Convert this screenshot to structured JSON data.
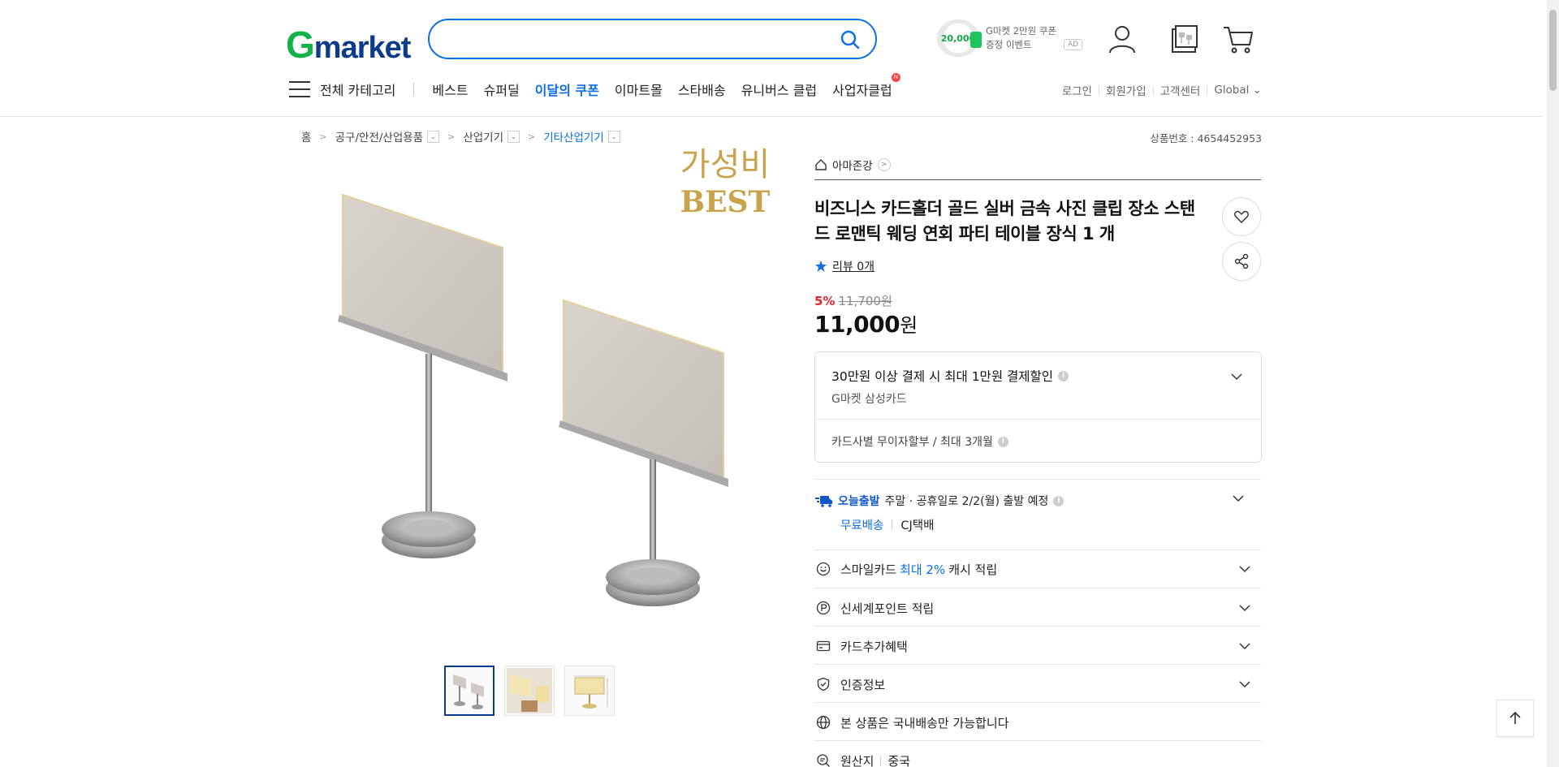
{
  "header": {
    "logo_g": "G",
    "logo_rest": "market",
    "search": {
      "placeholder": "",
      "value": ""
    },
    "promo": {
      "coin_value": "20,000",
      "line1": "G마켓 2만원 쿠폰",
      "line2": "증정 이벤트",
      "ad_label": "AD"
    },
    "icons": [
      "user-icon",
      "recent-items-icon",
      "cart-icon"
    ]
  },
  "nav": {
    "all_categories": "전체 카테고리",
    "items": [
      "베스트",
      "슈퍼딜",
      "이달의 쿠폰",
      "이마트몰",
      "스타배송",
      "유니버스 클럽",
      "사업자클럽"
    ],
    "highlighted_index": 2,
    "new_badge": "N",
    "util": [
      "로그인",
      "회원가입",
      "고객센터",
      "Global ⌄"
    ]
  },
  "breadcrumb": {
    "items": [
      "홈",
      "공구/안전/산업용품",
      "산업기기",
      "기타산업기기"
    ],
    "product_no": "상품번호 : 4654452953"
  },
  "product": {
    "image_badge_line1": "가성비",
    "image_badge_line2": "BEST",
    "shop_name": "아마존강",
    "title": "비즈니스 카드홀더 골드 실버 금속 사진 클립 장소 스탠드 로맨틱 웨딩 연회 파티 테이블 장식 1 개",
    "review": "리뷰 0개",
    "discount_pct": "5%",
    "original_price": "11,700원",
    "price_number": "11,000",
    "price_unit": "원"
  },
  "card_offer": {
    "title": "30만원 이상 결제 시 최대 1만원 결제할인",
    "subtitle": "G마켓 삼성카드",
    "installment": "카드사별 무이자할부 / 최대 3개월"
  },
  "shipping": {
    "today_label": "오늘출발",
    "schedule": "주말 · 공휴일로 2/2(월) 출발 예정",
    "free": "무료배송",
    "carrier": "CJ택배"
  },
  "benefits": [
    {
      "pre": "스마일카드",
      "blue": "최대 2%",
      "post": "캐시 적립",
      "icon": "smile-icon"
    },
    {
      "pre": "신세계포인트 적립",
      "blue": "",
      "post": "",
      "icon": "point-icon"
    },
    {
      "pre": "카드추가혜택",
      "blue": "",
      "post": "",
      "icon": "card-icon"
    },
    {
      "pre": "인증정보",
      "blue": "",
      "post": "",
      "icon": "shield-icon"
    },
    {
      "pre": "본 상품은 국내배송만 가능합니다",
      "blue": "",
      "post": "",
      "icon": "globe-icon"
    }
  ],
  "origin": {
    "label": "원산지",
    "value": "중국"
  },
  "colors": {
    "brand_blue": "#0c6ee7",
    "brand_green": "#11b348",
    "discount_red": "#e5252a"
  }
}
